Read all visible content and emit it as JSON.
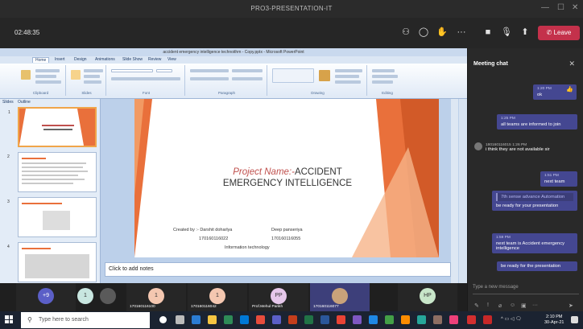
{
  "window": {
    "title": "PRO3-PRESENTATION-IT"
  },
  "meeting": {
    "timer": "02:48:35",
    "leave_label": "Leave",
    "icons": [
      "people-icon",
      "chat-icon",
      "raise-hand-icon",
      "more-icon",
      "camera-off-icon",
      "mic-icon",
      "share-icon",
      "phone-icon"
    ]
  },
  "powerpoint": {
    "title": "accident emergency intelligence technoithm - Copy.pptx - Microsoft PowerPoint",
    "tabs": [
      "Home",
      "Insert",
      "Design",
      "Animations",
      "Slide Show",
      "Review",
      "View"
    ],
    "groups": [
      "Clipboard",
      "Slides",
      "Font",
      "Paragraph",
      "Drawing",
      "Editing"
    ],
    "pane_tabs": [
      "Slides",
      "Outline"
    ],
    "slide_numbers": [
      "1",
      "2",
      "3",
      "4"
    ],
    "slide": {
      "title_prefix": "Project Name:-",
      "title_rest_line1": "ACCIDENT",
      "title_line2": "EMERGENCY INTELLIGENCE",
      "created_by": "Created by :- Darshit doharlya",
      "id1": "170160116022",
      "name2": "Deep panseriya",
      "id2": "170160116055",
      "dept": "Information technology"
    },
    "notes_placeholder": "Click to add notes",
    "self_label": "170160116035"
  },
  "chat": {
    "header": "Meeting chat",
    "messages": [
      {
        "ts": "1:20 PM",
        "text": "ok"
      },
      {
        "ts": "1:25 PM",
        "text": "all teams are informed to join"
      },
      {
        "sender": "180160116015",
        "ts": "1:26 PM",
        "text": "i think they are not available sir"
      },
      {
        "ts": "1:51 PM",
        "text": "next team"
      },
      {
        "quote": "7th sense advance Automation",
        "text": "be ready for your presentation"
      },
      {
        "ts": "1:59 PM",
        "text": "next team is Accident emergency intelligence"
      },
      {
        "text": "be ready for the presentation"
      }
    ],
    "input_placeholder": "Type a new message"
  },
  "participants": [
    {
      "initials": "+9",
      "name": "",
      "color": "#5b5fc7"
    },
    {
      "initials": "1",
      "name": "",
      "color": "#c8e6e0"
    },
    {
      "initials": "",
      "name": "",
      "color": "#777777"
    },
    {
      "initials": "1",
      "name": "170160116100",
      "color": "#f4c7b0"
    },
    {
      "initials": "1",
      "name": "170160116042",
      "color": "#f4c7b0"
    },
    {
      "initials": "PP",
      "name": "Prof.Mehul Parikh",
      "color": "#e6c7ea"
    },
    {
      "initials": "",
      "name": "170160116077",
      "color": "#5b5fc7"
    },
    {
      "initials": "HP",
      "name": "",
      "color": "#c8e6c9"
    }
  ],
  "taskbar": {
    "search_placeholder": "Type here to search",
    "time": "2:10 PM",
    "date": "30-Apr-21"
  }
}
